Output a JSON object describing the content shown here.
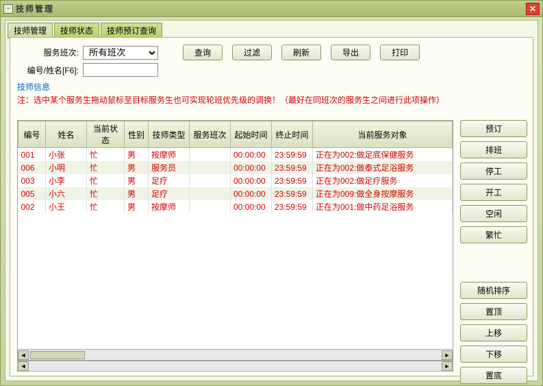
{
  "window": {
    "title": "技师管理"
  },
  "tabs": [
    {
      "label": "技师管理",
      "active": true
    },
    {
      "label": "技师状态",
      "active": false
    },
    {
      "label": "技师预订查询",
      "active": false
    }
  ],
  "fields": {
    "shift_label": "服务班次:",
    "shift_value": "所有班次",
    "search_label": "编号/姓名[F6]:",
    "search_value": ""
  },
  "toolbar": {
    "query": "查询",
    "filter": "过滤",
    "refresh": "刷新",
    "export": "导出",
    "print": "打印"
  },
  "info_label": "技师信息",
  "note": "注：选中某个服务生拖动鼠标至目标服务生也可实现轮班优先级的调换！（最好在同班次的服务生之间进行此项操作）",
  "columns": [
    "编号",
    "姓名",
    "当前状态",
    "性别",
    "技师类型",
    "服务班次",
    "起始时间",
    "终止时间",
    "当前服务对象"
  ],
  "rows": [
    {
      "id": "001",
      "name": "小张",
      "status": "忙",
      "gender": "男",
      "type": "按摩师",
      "shift": "",
      "start": "00:00:00",
      "end": "23:59:59",
      "target": "正在为002:做足底保健服务"
    },
    {
      "id": "006",
      "name": "小明",
      "status": "忙",
      "gender": "男",
      "type": "服务员",
      "shift": "",
      "start": "00:00:00",
      "end": "23:59:59",
      "target": "正在为002:做泰式足浴服务"
    },
    {
      "id": "003",
      "name": "小李",
      "status": "忙",
      "gender": "男",
      "type": "足疗",
      "shift": "",
      "start": "00:00:00",
      "end": "23:59:59",
      "target": "正在为002:做足疗服务"
    },
    {
      "id": "005",
      "name": "小六",
      "status": "忙",
      "gender": "男",
      "type": "足疗",
      "shift": "",
      "start": "00:00:00",
      "end": "23:59:59",
      "target": "正在为009:做全身按摩服务"
    },
    {
      "id": "002",
      "name": "小王",
      "status": "忙",
      "gender": "男",
      "type": "按摩师",
      "shift": "",
      "start": "00:00:00",
      "end": "23:59:59",
      "target": "正在为001:做中药足浴服务"
    }
  ],
  "side": {
    "reserve": "预订",
    "schedule": "排班",
    "stop": "停工",
    "start": "开工",
    "idle": "空闲",
    "busy": "繁忙",
    "random": "随机排序",
    "top": "置顶",
    "up": "上移",
    "down": "下移",
    "bottom": "置底"
  }
}
